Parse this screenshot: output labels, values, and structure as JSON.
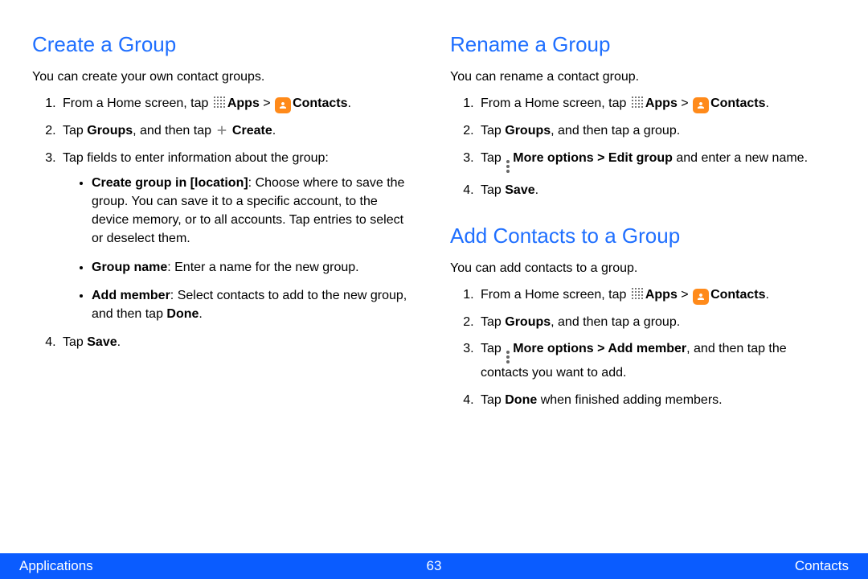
{
  "sections": {
    "create": {
      "heading": "Create a Group",
      "intro": "You can create your own contact groups.",
      "step1_prefix": "From a Home screen, tap ",
      "apps_label": "Apps",
      "gt": " > ",
      "contacts_label": "Contacts",
      "period": ".",
      "step2_a": "Tap ",
      "step2_b": "Groups",
      "step2_c": ", and then tap ",
      "step2_d": "Create",
      "step3": "Tap fields to enter information about the group:",
      "bullet1_b": "Create group in [location]",
      "bullet1_t": ": Choose where to save the group. You can save it to a specific account, to the device memory, or to all accounts. Tap entries to select or deselect them.",
      "bullet2_b": "Group name",
      "bullet2_t": ": Enter a name for the new group.",
      "bullet3_b": "Add member",
      "bullet3_t1": ": Select contacts to add to the new group, and then tap ",
      "bullet3_t2": "Done",
      "step4_a": "Tap ",
      "step4_b": "Save"
    },
    "rename": {
      "heading": "Rename a Group",
      "intro": "You can rename a contact group.",
      "step1_prefix": "From a Home screen, tap ",
      "apps_label": "Apps",
      "gt": " > ",
      "contacts_label": "Contacts",
      "period": ".",
      "step2_a": "Tap ",
      "step2_b": "Groups",
      "step2_c": ", and then tap a group.",
      "step3_a": "Tap ",
      "step3_b": "More options > Edit group",
      "step3_c": " and enter a new name.",
      "step4_a": "Tap ",
      "step4_b": "Save"
    },
    "add": {
      "heading": "Add Contacts to a Group",
      "intro": "You can add contacts to a group.",
      "step1_prefix": "From a Home screen, tap ",
      "apps_label": "Apps",
      "gt": " > ",
      "contacts_label": "Contacts",
      "period": ".",
      "step2_a": "Tap ",
      "step2_b": "Groups",
      "step2_c": ", and then tap a group.",
      "step3_a": "Tap ",
      "step3_b": "More options > Add member",
      "step3_c": ", and then tap the contacts you want to add.",
      "step4_a": "Tap ",
      "step4_b": "Done",
      "step4_c": " when finished adding members."
    }
  },
  "footer": {
    "left": "Applications",
    "center": "63",
    "right": "Contacts"
  }
}
